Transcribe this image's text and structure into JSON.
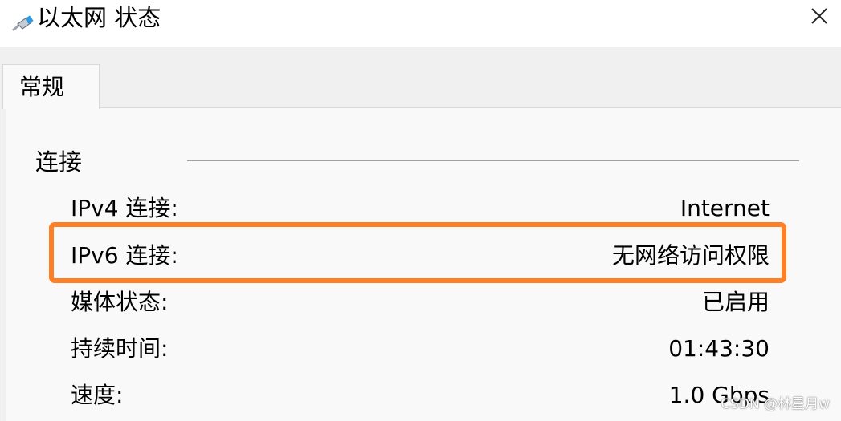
{
  "window": {
    "title": "以太网 状态",
    "icon": "ethernet-cable-icon",
    "close_icon": "close-icon"
  },
  "tabs": [
    {
      "label": "常规",
      "selected": true
    }
  ],
  "connection_group": {
    "label": "连接",
    "rows": [
      {
        "label": "IPv4 连接:",
        "value": "Internet"
      },
      {
        "label": "IPv6 连接:",
        "value": "无网络访问权限"
      },
      {
        "label": "媒体状态:",
        "value": "已启用"
      },
      {
        "label": "持续时间:",
        "value": "01:43:30"
      },
      {
        "label": "速度:",
        "value": "1.0 Gbps"
      }
    ]
  },
  "highlight_color": "#ff7f24",
  "watermark": "CSDN @林星月w"
}
